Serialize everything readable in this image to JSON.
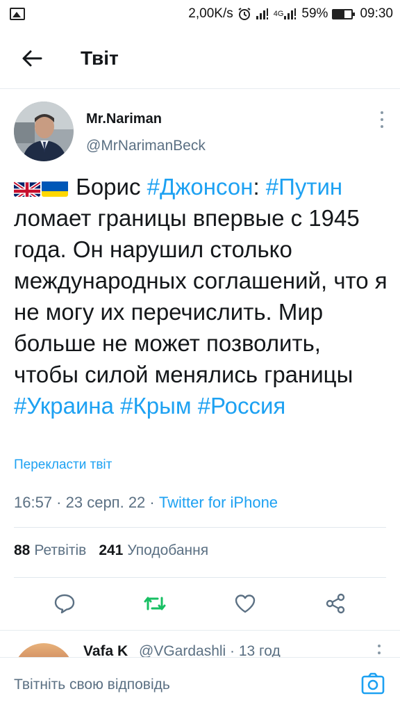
{
  "status_bar": {
    "network_speed": "2,00K/s",
    "network_type": "4G",
    "battery_percent": "59%",
    "battery_level": 0.59,
    "time": "09:30"
  },
  "header": {
    "title": "Твіт"
  },
  "tweet": {
    "author_name": "Mr.Nariman",
    "author_handle": "@MrNarimanBeck",
    "text": {
      "pre": "Борис ",
      "tag1": "#Джонсон",
      "mid1": ": ",
      "tag2": "#Путин",
      "body": " ломает границы впервые с 1945 года. Он нарушил столько международных соглашений, что я не могу их перечислить. Мир больше не может позволить, чтобы силой менялись границы ",
      "tag3": "#Украина",
      "sp1": " ",
      "tag4": "#Крым",
      "sp2": " ",
      "tag5": "#Россия"
    },
    "translate_label": "Перекласти твіт",
    "time": "16:57",
    "dot1": " · ",
    "date": "23 серп. 22",
    "dot2": " · ",
    "source": "Twitter for iPhone",
    "retweets_count": "88",
    "retweets_label": "Ретвітів",
    "likes_count": "241",
    "likes_label": "Уподобання"
  },
  "reply_preview": {
    "name": "Vafa K",
    "handle": "@VGardashli · 13 год"
  },
  "composer": {
    "placeholder": "Твітніть свою відповідь"
  },
  "colors": {
    "accent": "#1da1f2",
    "retweet_green": "#17bf63",
    "secondary_text": "#5b7083"
  }
}
